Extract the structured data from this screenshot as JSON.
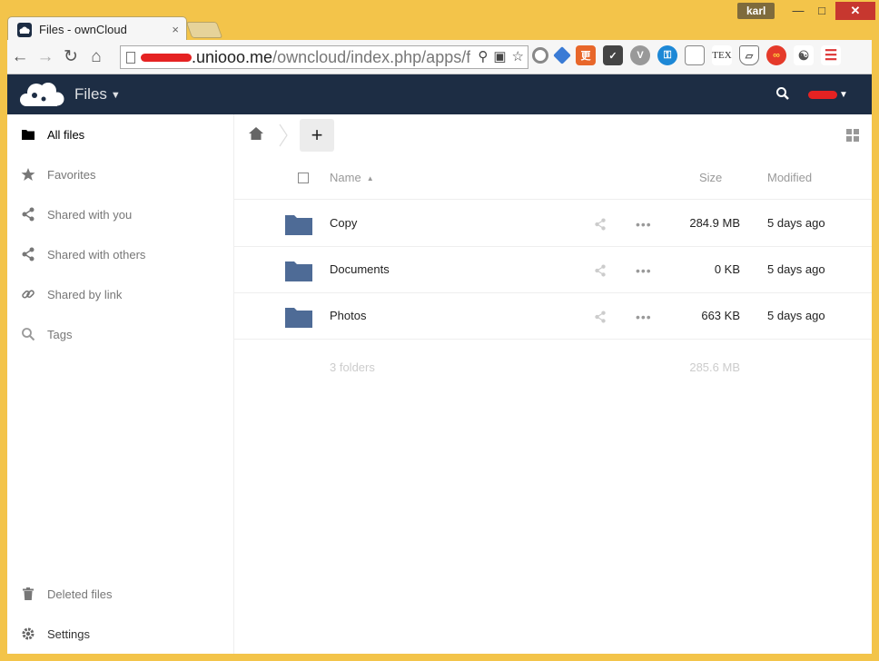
{
  "browser": {
    "tab_title": "Files - ownCloud",
    "tab_close": "×",
    "user_badge": "karl",
    "url_host": ".uniooo.me",
    "url_path": "/owncloud/index.php/apps/f",
    "extension_icons": [
      "circle-icon",
      "shield-diamond-icon",
      "translate-icon",
      "pocket-icon",
      "v-icon",
      "key-icon",
      "document-icon",
      "tex-icon",
      "shield-icon",
      "infinity-icon",
      "speaker-icon",
      "menu-icon"
    ]
  },
  "header": {
    "app_name": "Files",
    "accent": "#1d2d44"
  },
  "sidebar": {
    "items": [
      {
        "label": "All files",
        "icon": "folder-icon"
      },
      {
        "label": "Favorites",
        "icon": "star-icon"
      },
      {
        "label": "Shared with you",
        "icon": "share-icon"
      },
      {
        "label": "Shared with others",
        "icon": "share-icon"
      },
      {
        "label": "Shared by link",
        "icon": "link-icon"
      },
      {
        "label": "Tags",
        "icon": "search-icon"
      }
    ],
    "bottom": [
      {
        "label": "Deleted files",
        "icon": "trash-icon"
      },
      {
        "label": "Settings",
        "icon": "gear-icon"
      }
    ]
  },
  "files": {
    "new_label": "+",
    "columns": {
      "name": "Name",
      "size": "Size",
      "modified": "Modified"
    },
    "rows": [
      {
        "name": "Copy",
        "size": "284.9 MB",
        "modified": "5 days ago"
      },
      {
        "name": "Documents",
        "size": "0 KB",
        "modified": "5 days ago"
      },
      {
        "name": "Photos",
        "size": "663 KB",
        "modified": "5 days ago"
      }
    ],
    "summary": {
      "count": "3 folders",
      "size": "285.6 MB"
    },
    "folder_color": "#4e6b96"
  }
}
